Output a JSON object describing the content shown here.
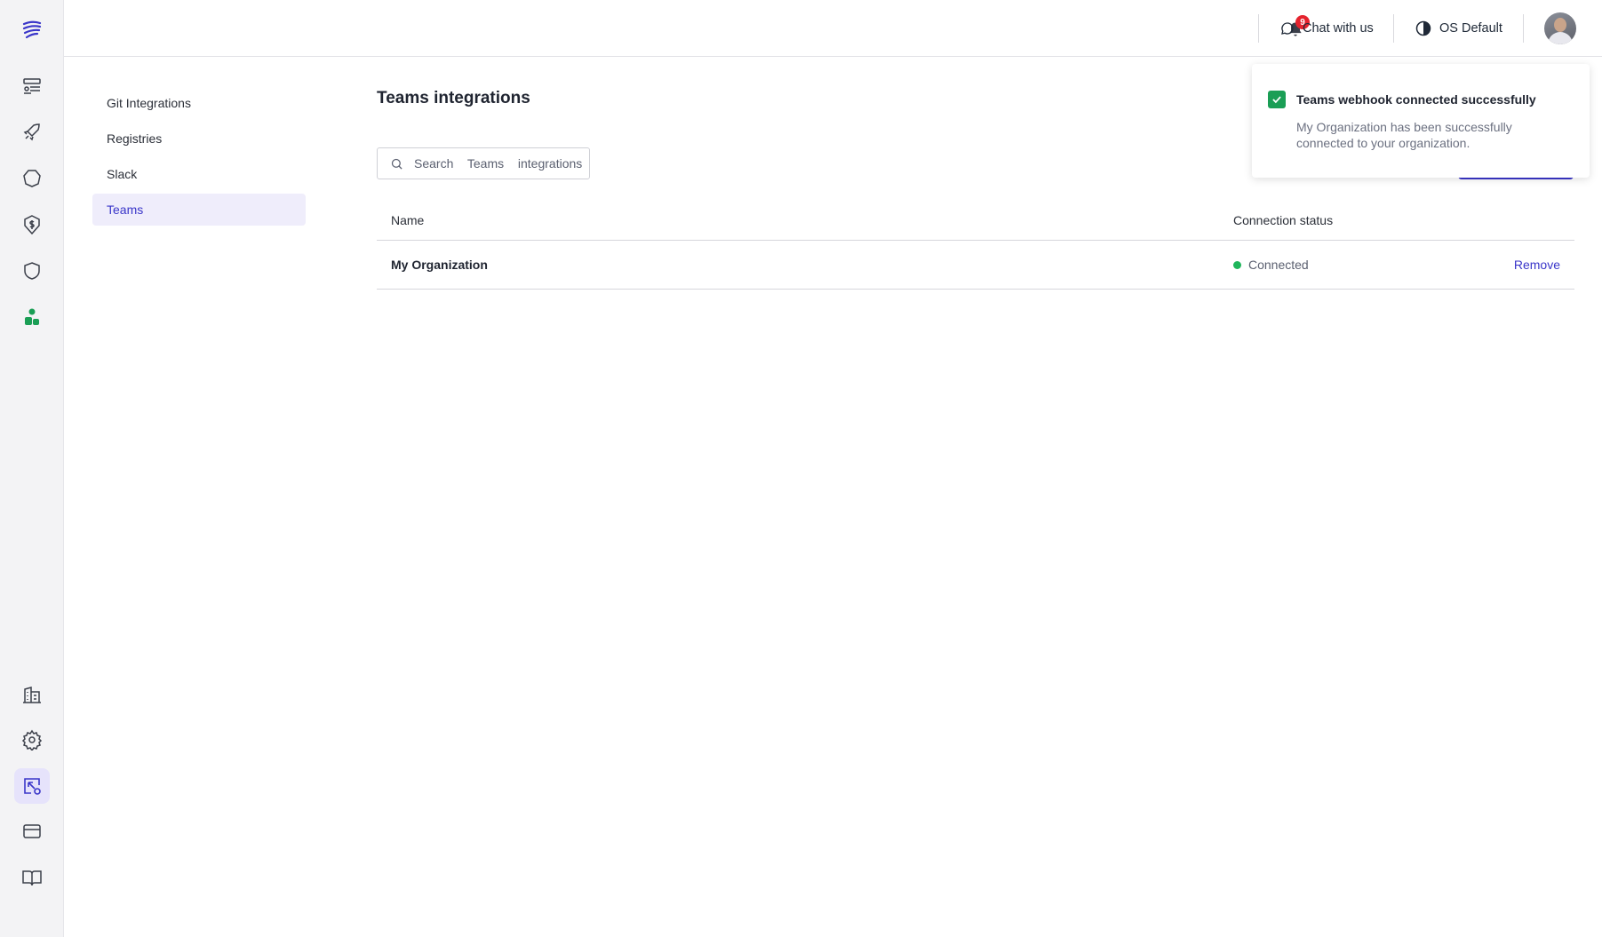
{
  "rail": {
    "logo": "brand-logo",
    "top_icons": [
      "dashboard-icon",
      "rocket-icon",
      "hexagon-icon",
      "dollar-shield-icon",
      "shield-icon",
      "team-icon"
    ],
    "bottom_icons": [
      "organization-icon",
      "gear-icon",
      "integrations-icon",
      "credit-card-icon",
      "book-icon"
    ],
    "active_icon": "integrations-icon",
    "accent_color": "#3a36c9",
    "team_icon_color": "#1a9e55"
  },
  "topbar": {
    "notification_count": "9",
    "chat_label": "Chat with us",
    "theme_label": "OS Default"
  },
  "subnav": {
    "items": [
      {
        "label": "Git Integrations"
      },
      {
        "label": "Registries"
      },
      {
        "label": "Slack"
      },
      {
        "label": "Teams"
      }
    ],
    "active_index": 3
  },
  "main": {
    "title": "Teams integrations",
    "search_placeholder": "Search  Teams  integrations",
    "table": {
      "columns": [
        "Name",
        "Connection status"
      ],
      "rows": [
        {
          "name": "My Organization",
          "status": "Connected",
          "action": "Remove"
        }
      ]
    }
  },
  "toast": {
    "title": "Teams webhook connected successfully",
    "message": "My Organization has been successfully connected to your organization."
  }
}
